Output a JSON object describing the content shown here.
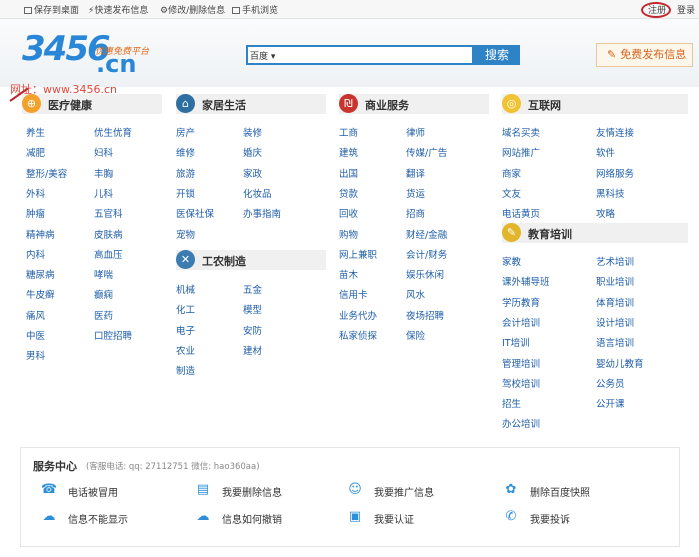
{
  "topbar": {
    "save_desktop": "保存到桌面",
    "quick_post": "快速发布信息",
    "edit_delete": "修改/删除信息",
    "mobile": "手机浏览",
    "register": "注册",
    "login": "登录"
  },
  "header": {
    "logo_number": "3456",
    "logo_domain": ".cn",
    "logo_slogan": "优惠免费平台",
    "url_label": "网址：www.3456.cn",
    "search_select": "百度",
    "search_button": "搜索",
    "free_post_button": "免费发布信息"
  },
  "sections": {
    "medical": {
      "title": "医疗健康",
      "color": "#f2a12b",
      "icon": "medical-icon",
      "col1": [
        "养生",
        "减肥",
        "整形/美容",
        "外科",
        "肿瘤",
        "精神病",
        "内科",
        "糖尿病",
        "牛皮癣",
        "痛风",
        "中医",
        "男科"
      ],
      "col2": [
        "优生优育",
        "妇科",
        "丰胸",
        "儿科",
        "五官科",
        "皮肤病",
        "高血压",
        "哮喘",
        "癫痫",
        "医药",
        "口腔招聘"
      ]
    },
    "home": {
      "title": "家居生活",
      "color": "#2c6fa0",
      "icon": "house-icon",
      "col1": [
        "房产",
        "维修",
        "旅游",
        "开锁",
        "医保社保",
        "宠物"
      ],
      "col2": [
        "装修",
        "婚庆",
        "家政",
        "化妆品",
        "办事指南"
      ]
    },
    "industry": {
      "title": "工农制造",
      "color": "#3c7cb1",
      "icon": "tools-icon",
      "col1": [
        "机械",
        "化工",
        "电子",
        "农业",
        "制造"
      ],
      "col2": [
        "五金",
        "模型",
        "安防",
        "建材"
      ]
    },
    "business": {
      "title": "商业服务",
      "color": "#c8352e",
      "icon": "business-icon",
      "col1": [
        "工商",
        "建筑",
        "出国",
        "贷款",
        "回收",
        "购物",
        "网上兼职",
        "苗木",
        "信用卡",
        "业务代办",
        "私家侦探"
      ],
      "col2": [
        "律师",
        "传媒/广告",
        "翻译",
        "货运",
        "招商",
        "财经/金融",
        "会计/财务",
        "娱乐休闲",
        "风水",
        "夜场招聘",
        "保险"
      ]
    },
    "internet": {
      "title": "互联网",
      "color": "#f1c232",
      "icon": "globe-icon",
      "col1": [
        "域名买卖",
        "网站推广",
        "商家",
        "文友",
        "电话黄页"
      ],
      "col2": [
        "友情连接",
        "软件",
        "网络服务",
        "黑科技",
        "攻略"
      ]
    },
    "education": {
      "title": "教育培训",
      "color": "#e2b52a",
      "icon": "education-icon",
      "col1": [
        "家教",
        "课外辅导班",
        "学历教育",
        "会计培训",
        "IT培训",
        "管理培训",
        "驾校培训",
        "招生",
        "办公培训"
      ],
      "col2": [
        "艺术培训",
        "职业培训",
        "体育培训",
        "设计培训",
        "语言培训",
        "婴幼儿教育",
        "公务员",
        "公开课"
      ]
    }
  },
  "service": {
    "title": "服务中心",
    "contact": "(客服电话: qq: 27112751 微信: hao360aa)",
    "items": [
      {
        "label": "电话被冒用",
        "icon": "phone-icon"
      },
      {
        "label": "我要删除信息",
        "icon": "document-delete-icon"
      },
      {
        "label": "我要推广信息",
        "icon": "users-icon"
      },
      {
        "label": "删除百度快照",
        "icon": "baidu-paw-icon"
      },
      {
        "label": "信息不能显示",
        "icon": "cloud-icon"
      },
      {
        "label": "信息如何撤销",
        "icon": "cloud-download-icon"
      },
      {
        "label": "我要认证",
        "icon": "certificate-icon"
      },
      {
        "label": "我要投诉",
        "icon": "complaint-phone-icon"
      }
    ]
  }
}
